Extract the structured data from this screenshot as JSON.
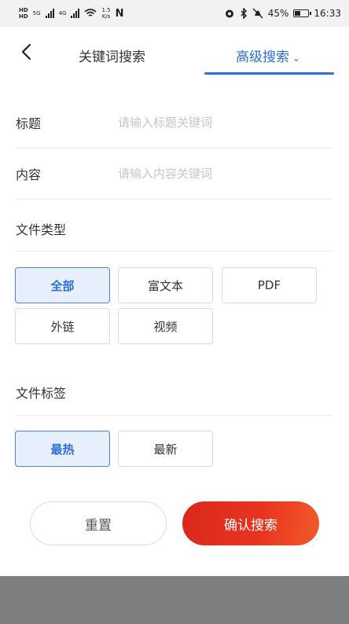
{
  "status_bar": {
    "hd_top": "HD",
    "hd_bottom": "HD",
    "sig1_label": "5G",
    "sig2_label": "4G",
    "speed_value": "1.5",
    "speed_unit": "K/s",
    "nfc": "N",
    "battery_percent": "45%",
    "battery_level": 0.45,
    "time": "16:33"
  },
  "header": {
    "tab_keyword": "关键词搜索",
    "tab_advanced": "高级搜索",
    "caret": "⌄"
  },
  "form": {
    "title_label": "标题",
    "title_placeholder": "请输入标题关键词",
    "content_label": "内容",
    "content_placeholder": "请输入内容关键词"
  },
  "file_type": {
    "title": "文件类型",
    "options": [
      "全部",
      "富文本",
      "PDF",
      "外链",
      "视频"
    ],
    "selected": "全部"
  },
  "file_tag": {
    "title": "文件标签",
    "options": [
      "最热",
      "最新"
    ],
    "selected": "最热"
  },
  "actions": {
    "reset": "重置",
    "confirm": "确认搜索"
  },
  "colors": {
    "accent": "#2f6fd8",
    "confirm": "#e32d1e"
  }
}
